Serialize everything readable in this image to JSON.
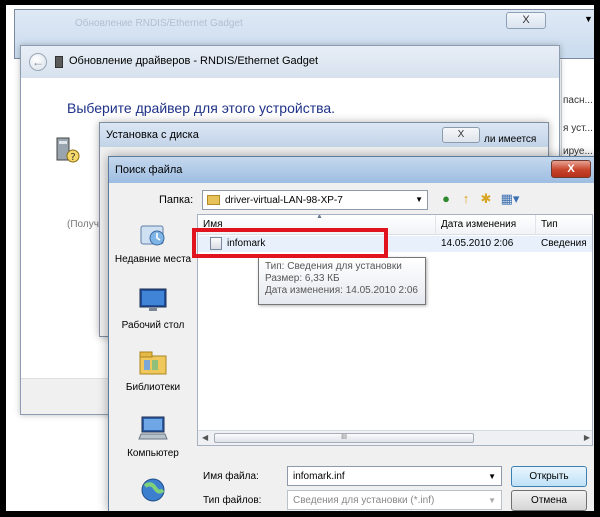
{
  "background": {
    "ghost_title": "Обновление RNDIS/Ethernet Gadget",
    "close_label": "X",
    "side_texts": [
      "пасн...",
      "я уст...",
      "ируе..."
    ]
  },
  "wizard": {
    "back_glyph": "←",
    "title": "Обновление драйверов - RNDIS/Ethernet Gadget",
    "heading": "Выберите драйвер для этого устройства.",
    "received_text": "(Получ"
  },
  "disk_dialog": {
    "title": "Установка с диска",
    "close_label": "X",
    "available_text": "ли имеется"
  },
  "file_dialog": {
    "title": "Поиск файла",
    "close_label": "X",
    "folder_label": "Папка:",
    "folder_value": "driver-virtual-LAN-98-XP-7",
    "places": [
      {
        "label": "Недавние места",
        "icon": "recent-places-icon"
      },
      {
        "label": "Рабочий стол",
        "icon": "desktop-icon"
      },
      {
        "label": "Библиотеки",
        "icon": "libraries-icon"
      },
      {
        "label": "Компьютер",
        "icon": "computer-icon"
      },
      {
        "label": "",
        "icon": "network-icon"
      }
    ],
    "columns": [
      "Имя",
      "Дата изменения",
      "Тип"
    ],
    "files": [
      {
        "name": "infomark",
        "date": "14.05.2010 2:06",
        "type": "Сведения"
      }
    ],
    "tooltip": {
      "type": "Тип: Сведения для установки",
      "size": "Размер: 6,33 КБ",
      "modified": "Дата изменения: 14.05.2010 2:06"
    },
    "scroll_grip": "III",
    "filename_label": "Имя файла:",
    "filename_value": "infomark.inf",
    "filetype_label": "Тип файлов:",
    "filetype_value": "Сведения для установки (*.inf)",
    "open_label": "Открыть",
    "cancel_label": "Отмена"
  },
  "colors": {
    "highlight": "#e0131e",
    "heading": "#1e3287",
    "close_red": "#c7442b"
  }
}
